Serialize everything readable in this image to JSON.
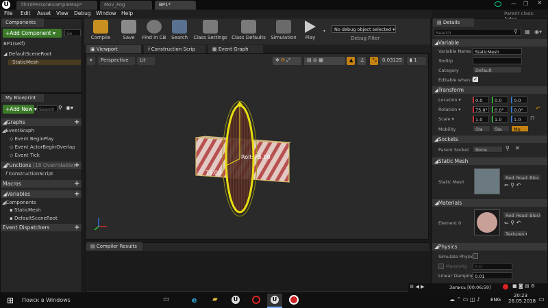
{
  "titlebar": {
    "tabs": [
      "ThirdPersonExampleMap*",
      "Mov_Fog",
      "BP1*"
    ],
    "parent_class_label": "Parent class:",
    "parent_class_value": "Actor"
  },
  "menu": [
    "File",
    "Edit",
    "Asset",
    "View",
    "Debug",
    "Window",
    "Help"
  ],
  "components": {
    "tab": "Components",
    "add_label": "+Add Component ▾",
    "search_placeholder": "Se",
    "items": [
      "BP1(self)",
      "DefaultSceneRoot",
      "StaticMesh"
    ]
  },
  "toolbar": {
    "buttons": [
      "Compile",
      "Save",
      "Find in CB",
      "Search",
      "Class Settings",
      "Class Defaults",
      "Simulation",
      "Play"
    ],
    "debug_object": "No debug object selected ▾",
    "debug_filter": "Debug Filter"
  },
  "editor_tabs": [
    "Viewport",
    "Construction Scrip",
    "Event Graph"
  ],
  "viewport": {
    "perspective": "Perspective",
    "lit": "Lit",
    "snap_value": "0.03125",
    "camera_speed": "1",
    "roll_label": "Roll: 75.00",
    "angle_label": "75.00"
  },
  "my_blueprint": {
    "tab": "My Blueprint",
    "add_new": "+Add New ▾",
    "search_placeholder": "Search",
    "graphs_header": "Graphs",
    "event_graph": "EventGraph",
    "events": [
      "Event BeginPlay",
      "Event ActorBeginOverlap",
      "Event Tick"
    ],
    "functions_header": "Functions",
    "functions_note": "(18 Overridable)",
    "construction_script": "ConstructionScript",
    "macros_header": "Macros",
    "variables_header": "Variables",
    "components_header": "Components",
    "component_items": [
      "StaticMesh",
      "DefaultSceneRoot"
    ],
    "dispatchers_header": "Event Dispatchers"
  },
  "compiler": {
    "tab": "Compiler Results"
  },
  "details": {
    "tab": "Details",
    "search_placeholder": "Search",
    "variable": {
      "header": "Variable",
      "name_label": "Variable Name",
      "name_value": "StaticMesh",
      "tooltip_label": "Tooltip",
      "category_label": "Category",
      "category_value": "Default",
      "editable_label": "Editable when In"
    },
    "transform": {
      "header": "Transform",
      "location_label": "Location ▾",
      "location": [
        "0.0",
        "0.0",
        "0.0"
      ],
      "rotation_label": "Rotation ▾",
      "rotation": [
        "75.0°",
        "0.0°",
        "0.0°"
      ],
      "scale_label": "Scale ▾",
      "scale": [
        "1.0",
        "1.0",
        "1.0"
      ],
      "mobility_label": "Mobility",
      "mobility_options": [
        "Sta",
        "Sta",
        "Mo"
      ]
    },
    "sockets": {
      "header": "Sockets",
      "parent_label": "Parent Socket",
      "parent_value": "None"
    },
    "static_mesh": {
      "header": "Static Mesh",
      "label": "Static Mesh",
      "asset": "Red_Road_Bloc ▾"
    },
    "materials": {
      "header": "Materials",
      "element_label": "Element 0",
      "asset": "Red_Road_Block ▾",
      "textures": "Textures ▾"
    },
    "physics": {
      "header": "Physics",
      "simulate_label": "Simulate Physic",
      "mass_label": "MassInKg",
      "mass_value": "0.0",
      "damping_label": "Linear Damping",
      "damping_value": "0.01"
    }
  },
  "recording": {
    "label": "Запись [00:06:59]"
  },
  "taskbar": {
    "search_text": "Поиск в Windows",
    "lang": "ENG",
    "time": "20:23",
    "date": "26.05.2018"
  },
  "colors": {
    "accent": "#3c7a2a",
    "bg": "#262626"
  }
}
